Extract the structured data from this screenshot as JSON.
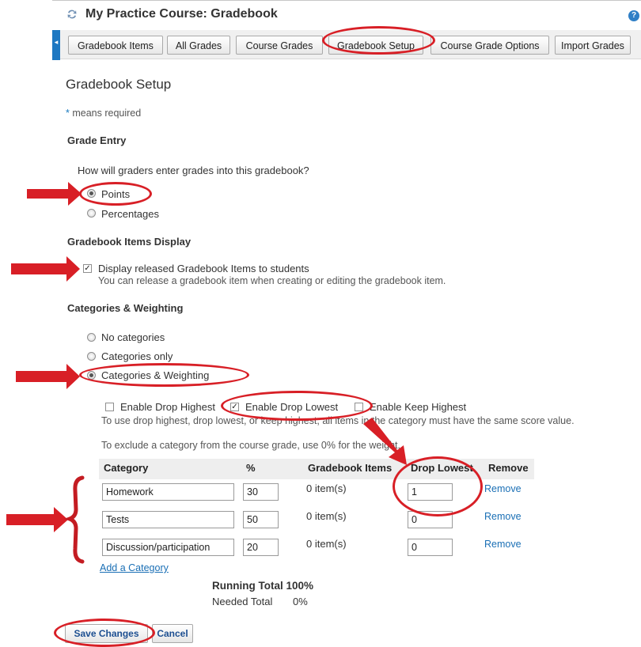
{
  "header": {
    "course_title": "My Practice Course: Gradebook",
    "help_icon": "?",
    "tabs": [
      "Gradebook Items",
      "All Grades",
      "Course Grades",
      "Gradebook Setup",
      "Course Grade Options",
      "Import Grades"
    ]
  },
  "page": {
    "title": "Gradebook Setup",
    "required_star": "*",
    "required_text": " means required"
  },
  "grade_entry": {
    "heading": "Grade Entry",
    "question": "How will graders enter grades into this gradebook?",
    "options": [
      "Points",
      "Percentages"
    ],
    "selected": "Points"
  },
  "items_display": {
    "heading": "Gradebook Items Display",
    "checkbox_label": "Display released Gradebook Items to students",
    "checked": true,
    "help": "You can release a gradebook item when creating or editing the gradebook item."
  },
  "categories": {
    "heading": "Categories & Weighting",
    "options": [
      "No categories",
      "Categories only",
      "Categories & Weighting"
    ],
    "selected": "Categories & Weighting",
    "drop_options": [
      "Enable Drop Highest",
      "Enable Drop Lowest",
      "Enable Keep Highest"
    ],
    "drop_checked": [
      false,
      true,
      false
    ],
    "drop_help": "To use drop highest, drop lowest, or keep highest, all items in the category must have the same score value.",
    "exclude_help": "To exclude a category from the course grade, use 0% for the weight."
  },
  "table": {
    "headers": [
      "Category",
      "%",
      "Gradebook Items",
      "Drop Lowest",
      "Remove"
    ],
    "rows": [
      {
        "category": "Homework",
        "percent": "30",
        "items": "0 item(s)",
        "drop": "1",
        "remove": "Remove"
      },
      {
        "category": "Tests",
        "percent": "50",
        "items": "0 item(s)",
        "drop": "0",
        "remove": "Remove"
      },
      {
        "category": "Discussion/participation",
        "percent": "20",
        "items": "0 item(s)",
        "drop": "0",
        "remove": "Remove"
      }
    ],
    "add_link": "Add a Category",
    "running_total": "Running Total 100%",
    "needed_label": "Needed Total",
    "needed_value": "0%"
  },
  "buttons": {
    "save": "Save Changes",
    "cancel": "Cancel"
  },
  "colors": {
    "annotation": "#d81f26",
    "link": "#1a6fb5",
    "side_tab": "#1e78c2"
  }
}
